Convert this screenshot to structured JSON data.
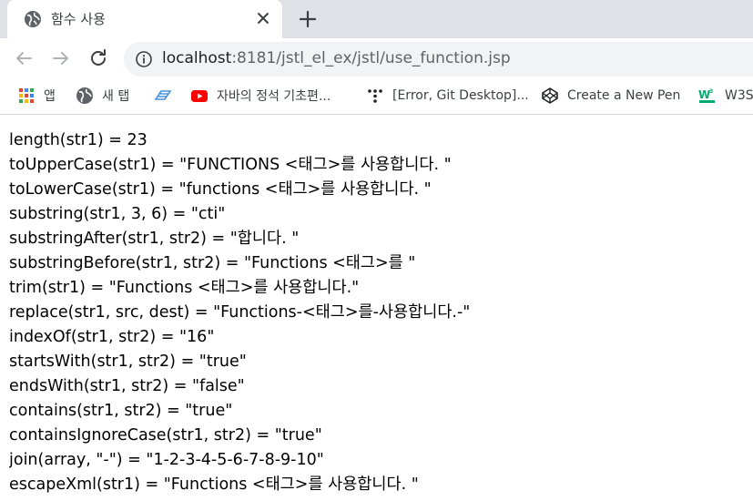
{
  "tab": {
    "title": "함수 사용",
    "favicon": "globe-icon",
    "close_icon": "close-icon",
    "new_tab_icon": "plus-icon"
  },
  "toolbar": {
    "back_icon": "arrow-left-icon",
    "forward_icon": "arrow-right-icon",
    "reload_icon": "reload-icon",
    "info_icon": "info-circle-icon",
    "url_host": "localhost",
    "url_rest": ":8181/jstl_el_ex/jstl/use_function.jsp"
  },
  "bookmarks": [
    {
      "label": "앱",
      "icon": "apps-grid-icon"
    },
    {
      "label": "새 탭",
      "icon": "globe-icon"
    },
    {
      "label": "",
      "icon": "blue-wing-icon"
    },
    {
      "label": "자바의 정석 기초편...",
      "icon": "youtube-icon"
    },
    {
      "label": "[Error, Git Desktop]...",
      "icon": "dots-logo-icon"
    },
    {
      "label": "Create a New Pen",
      "icon": "codepen-icon"
    },
    {
      "label": "W3S",
      "icon": "w3schools-icon"
    }
  ],
  "lines": [
    "length(str1) = 23",
    "toUpperCase(str1) = \"FUNCTIONS <태그>를 사용합니다. \"",
    "toLowerCase(str1) = \"functions <태그>를 사용합니다. \"",
    "substring(str1, 3, 6) = \"cti\"",
    "substringAfter(str1, str2) = \"합니다. \"",
    "substringBefore(str1, str2) = \"Functions <태그>를 \"",
    "trim(str1) = \"Functions <태그>를 사용합니다.\"",
    "replace(str1, src, dest) = \"Functions-<태그>를-사용합니다.-\"",
    "indexOf(str1, str2) = \"16\"",
    "startsWith(str1, str2) = \"true\"",
    "endsWith(str1, str2) = \"false\"",
    "contains(str1, str2) = \"true\"",
    "containsIgnoreCase(str1, str2) = \"true\"",
    "join(array, \"-\") = \"1-2-3-4-5-6-7-8-9-10\"",
    "escapeXml(str1) = \"Functions <태그>를 사용합니다. \""
  ]
}
